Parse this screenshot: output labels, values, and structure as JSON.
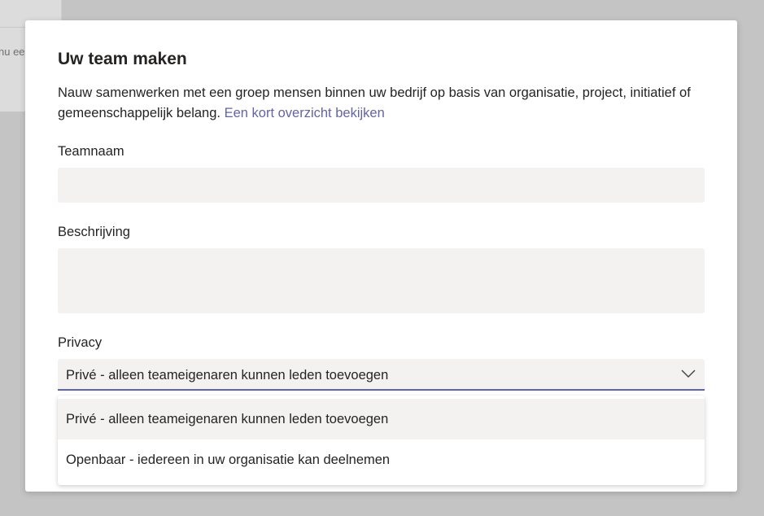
{
  "background": {
    "snippet": "nu ee"
  },
  "dialog": {
    "title": "Uw team maken",
    "description": "Nauw samenwerken met een groep mensen binnen uw bedrijf op basis van organisatie, project, initiatief of gemeenschappelijk belang.",
    "overview_link": "Een kort overzicht bekijken",
    "team_name": {
      "label": "Teamnaam",
      "value": "",
      "placeholder": ""
    },
    "description_field": {
      "label": "Beschrijving",
      "value": "",
      "placeholder": ""
    },
    "privacy": {
      "label": "Privacy",
      "selected": "Privé - alleen teameigenaren kunnen leden toevoegen",
      "options": [
        "Privé - alleen teameigenaren kunnen leden toevoegen",
        "Openbaar - iedereen in uw organisatie kan deelnemen"
      ]
    }
  },
  "colors": {
    "accent": "#6264a7",
    "field_bg": "#f3f2f1",
    "text": "#252423",
    "overlay": "#c4c4c4"
  },
  "icons": {
    "dropdown": "chevron-down-icon"
  }
}
